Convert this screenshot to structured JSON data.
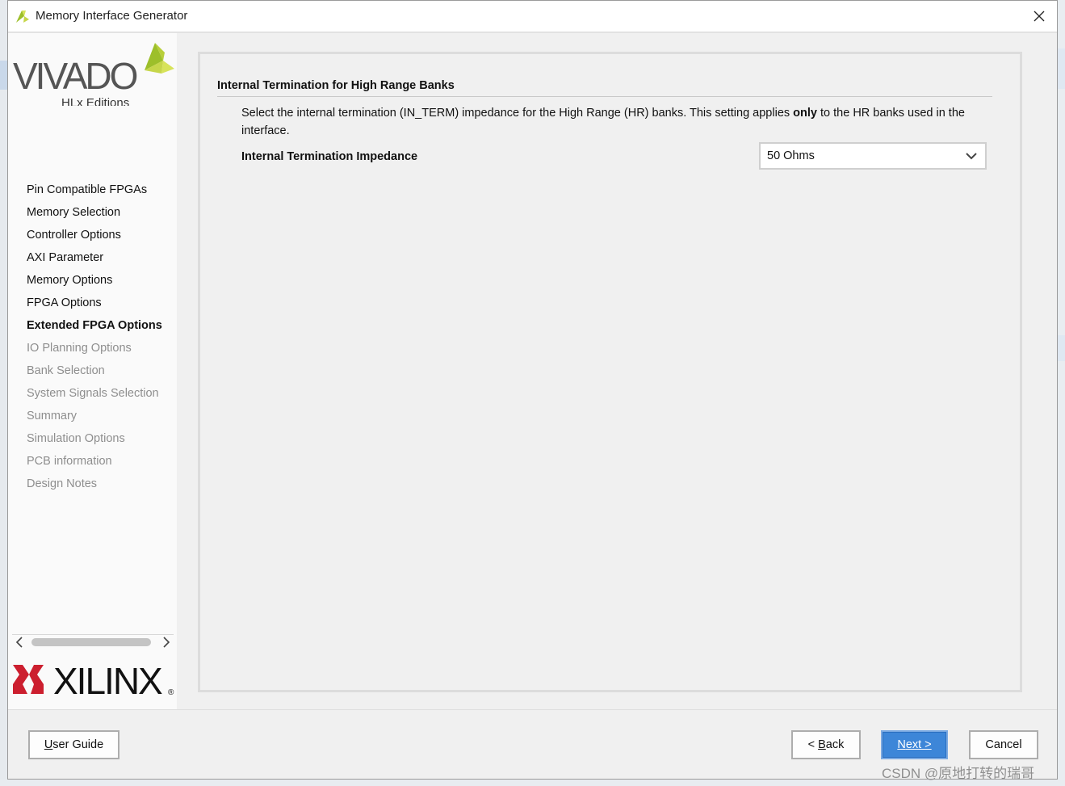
{
  "window": {
    "title": "Memory Interface Generator"
  },
  "branding": {
    "vivado_wordmark": "VIVADO",
    "vivado_edition": "HLx Editions",
    "xilinx_wordmark": "XILINX",
    "registered_mark": "®"
  },
  "sidebar": {
    "items": [
      {
        "label": "Pin Compatible FPGAs",
        "state": "done"
      },
      {
        "label": "Memory Selection",
        "state": "done"
      },
      {
        "label": "Controller Options",
        "state": "done"
      },
      {
        "label": "AXI Parameter",
        "state": "done"
      },
      {
        "label": "Memory Options",
        "state": "done"
      },
      {
        "label": "FPGA Options",
        "state": "done"
      },
      {
        "label": "Extended FPGA Options",
        "state": "current"
      },
      {
        "label": "IO Planning Options",
        "state": "disabled"
      },
      {
        "label": "Bank Selection",
        "state": "disabled"
      },
      {
        "label": "System Signals Selection",
        "state": "disabled"
      },
      {
        "label": "Summary",
        "state": "disabled"
      },
      {
        "label": "Simulation Options",
        "state": "disabled"
      },
      {
        "label": "PCB information",
        "state": "disabled"
      },
      {
        "label": "Design Notes",
        "state": "disabled"
      }
    ]
  },
  "main": {
    "section_title": "Internal Termination for High Range Banks",
    "description_before": "Select the internal termination (IN_TERM) impedance for the High Range (HR) banks. This setting applies ",
    "description_bold": "only",
    "description_after": " to the HR banks used in the interface.",
    "field_label": "Internal Termination Impedance",
    "field_value": "50 Ohms"
  },
  "footer": {
    "user_guide": {
      "accel": "U",
      "rest": "ser Guide"
    },
    "back": {
      "prefix": "< ",
      "accel": "B",
      "rest": "ack"
    },
    "next": {
      "accel": "N",
      "rest": "ext >"
    },
    "cancel": "Cancel"
  },
  "watermark": "CSDN @原地打转的瑞哥",
  "colors": {
    "vivado_green": "#9dbf2a",
    "vivado_yellow": "#d7e35a",
    "xilinx_red": "#cc1f2f",
    "primary_button": "#3d86d8"
  }
}
